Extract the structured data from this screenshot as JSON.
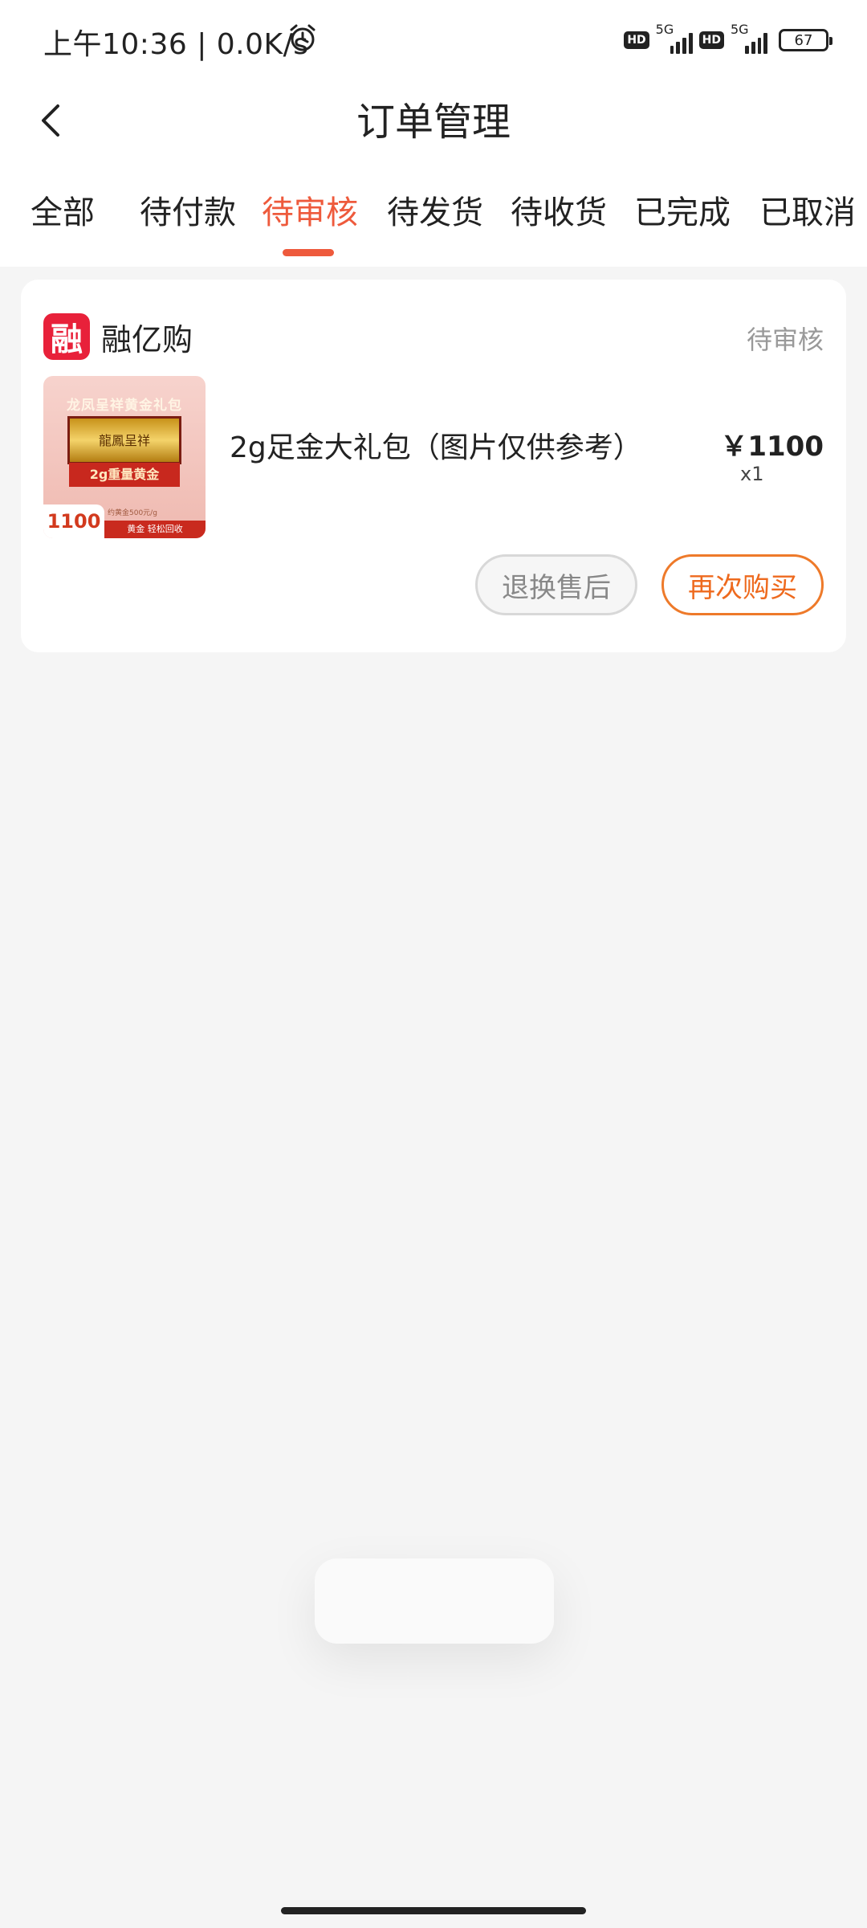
{
  "status_bar": {
    "time_speed": "上午10:36 | 0.0K/s",
    "network_label_1": "HD",
    "network_gen_1": "5G",
    "network_label_2": "HD",
    "network_gen_2": "5G",
    "battery": "67"
  },
  "nav": {
    "title": "订单管理"
  },
  "tabs": [
    {
      "label": "全部"
    },
    {
      "label": "待付款"
    },
    {
      "label": "待审核",
      "active": true
    },
    {
      "label": "待发货"
    },
    {
      "label": "待收货"
    },
    {
      "label": "已完成"
    },
    {
      "label": "已取消"
    }
  ],
  "order": {
    "shop": {
      "logo_text": "融",
      "name": "融亿购"
    },
    "status": "待审核",
    "product": {
      "name": "2g足金大礼包（图片仅供参考）",
      "price": "￥1100",
      "quantity": "x1",
      "thumbnail": {
        "headline": "龙凤呈祥黄金礼包",
        "bar_text": "龍鳳呈祥",
        "ribbon": "2g重量黄金",
        "price": "1100",
        "note": "约黄金500元/g",
        "foot": "黄金 轻松回收"
      }
    },
    "actions": {
      "aftersale": "退换售后",
      "rebuy": "再次购买"
    }
  },
  "colors": {
    "accent": "#ee5a3c",
    "rebuy": "#ee6a1e",
    "shop_logo": "#e8213a",
    "background": "#f5f5f5"
  }
}
